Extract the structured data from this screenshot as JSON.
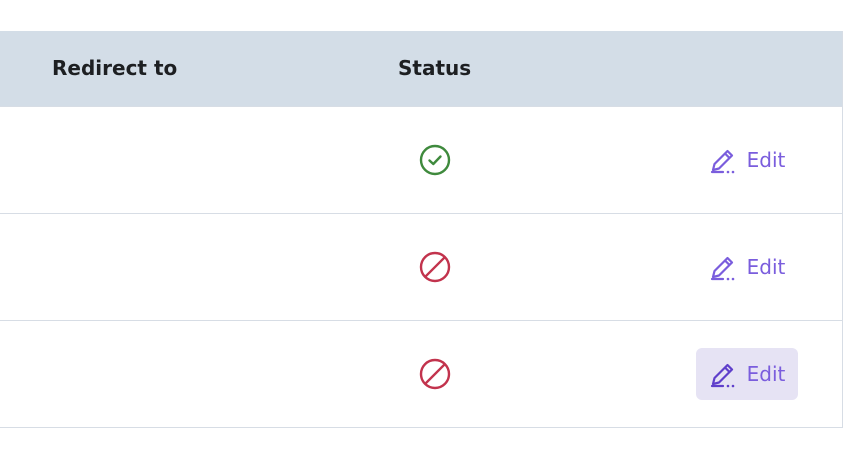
{
  "table": {
    "headers": {
      "redirect_to": "Redirect to",
      "status": "Status"
    },
    "rows": [
      {
        "redirect_to": "",
        "status": "active",
        "status_icon": "check-circle-icon",
        "edit_label": "Edit",
        "edit_hover": false
      },
      {
        "redirect_to": "",
        "status": "disabled",
        "status_icon": "blocked-circle-icon",
        "edit_label": "Edit",
        "edit_hover": false
      },
      {
        "redirect_to": "",
        "status": "disabled",
        "status_icon": "blocked-circle-icon",
        "edit_label": "Edit",
        "edit_hover": true
      }
    ]
  },
  "colors": {
    "header_bg": "#d3dde7",
    "status_active": "#3f8a3d",
    "status_disabled": "#c2334d",
    "edit_accent": "#7a5ddd",
    "edit_hover_bg": "#e6e3f4",
    "border": "#d7dde5"
  }
}
